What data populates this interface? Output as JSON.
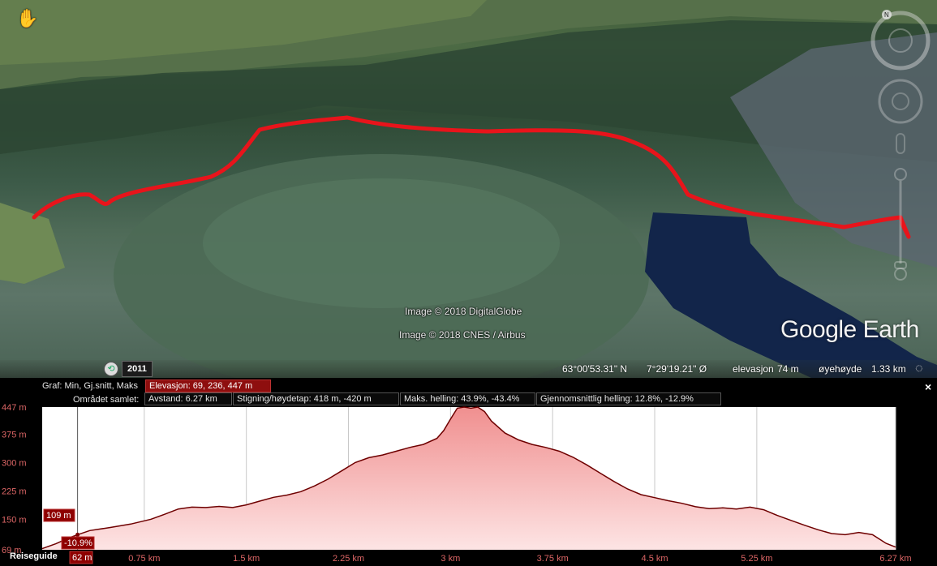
{
  "map": {
    "attribution_1": "Image © 2018 DigitalGlobe",
    "attribution_2": "Image © 2018 CNES / Airbus",
    "logo": "Google Earth",
    "year": "2011",
    "compass_letter": "N",
    "route_color": "#e8141b",
    "lake_color": "#12254a"
  },
  "status": {
    "latitude": "63°00'53.31\" N",
    "longitude": "7°29'19.21\" Ø",
    "elevation_label": "elevasjon",
    "elevation_value": "74 m",
    "eye_label": "øyehøyde",
    "eye_value": "1.33 km"
  },
  "profile": {
    "row1_label": "Graf: Min, Gj.snitt, Maks",
    "elevation_stats": "Elevasjon: 69, 236, 447 m",
    "row2_label": "Området samlet:",
    "distance": "Avstand: 6.27 km",
    "climb": "Stigning/høydetap: 418 m, -420 m",
    "max_grade": "Maks. helling: 43.9%, -43.4%",
    "avg_grade": "Gjennomsnittlig helling: 12.8%, -12.9%",
    "close": "×",
    "guide": "Reiseguide",
    "cursor_elevation": "109 m",
    "cursor_grade": "-10.9%",
    "cursor_distance": "62 m"
  },
  "chart_data": {
    "type": "area",
    "x_unit": "km",
    "y_unit": "m",
    "ylim": [
      69,
      447
    ],
    "xlim": [
      0,
      6.27
    ],
    "yticks": [
      "447 m",
      "375 m",
      "300 m",
      "225 m",
      "150 m",
      "69 m"
    ],
    "xticks": [
      "0.75 km",
      "1.5 km",
      "2.25 km",
      "3 km",
      "3.75 km",
      "4.5 km",
      "5.25 km",
      "6.27 km"
    ],
    "fill_color": "#f5b3b3",
    "line_color": "#6e0000",
    "points": [
      [
        0,
        72
      ],
      [
        0.1,
        85
      ],
      [
        0.2,
        101
      ],
      [
        0.26,
        109
      ],
      [
        0.35,
        120
      ],
      [
        0.5,
        128
      ],
      [
        0.65,
        137
      ],
      [
        0.8,
        150
      ],
      [
        0.9,
        163
      ],
      [
        1.0,
        177
      ],
      [
        1.1,
        182
      ],
      [
        1.2,
        181
      ],
      [
        1.3,
        184
      ],
      [
        1.4,
        181
      ],
      [
        1.5,
        188
      ],
      [
        1.6,
        198
      ],
      [
        1.7,
        208
      ],
      [
        1.8,
        214
      ],
      [
        1.9,
        223
      ],
      [
        2.0,
        238
      ],
      [
        2.1,
        256
      ],
      [
        2.2,
        278
      ],
      [
        2.3,
        300
      ],
      [
        2.4,
        313
      ],
      [
        2.5,
        320
      ],
      [
        2.6,
        330
      ],
      [
        2.7,
        340
      ],
      [
        2.8,
        348
      ],
      [
        2.9,
        364
      ],
      [
        2.95,
        385
      ],
      [
        3.0,
        415
      ],
      [
        3.05,
        444
      ],
      [
        3.1,
        447
      ],
      [
        3.15,
        444
      ],
      [
        3.2,
        447
      ],
      [
        3.25,
        435
      ],
      [
        3.3,
        410
      ],
      [
        3.4,
        378
      ],
      [
        3.5,
        360
      ],
      [
        3.6,
        348
      ],
      [
        3.7,
        340
      ],
      [
        3.8,
        330
      ],
      [
        3.9,
        314
      ],
      [
        4.0,
        294
      ],
      [
        4.1,
        272
      ],
      [
        4.2,
        250
      ],
      [
        4.3,
        230
      ],
      [
        4.4,
        215
      ],
      [
        4.5,
        207
      ],
      [
        4.6,
        199
      ],
      [
        4.7,
        192
      ],
      [
        4.8,
        183
      ],
      [
        4.9,
        178
      ],
      [
        5.0,
        180
      ],
      [
        5.1,
        177
      ],
      [
        5.2,
        182
      ],
      [
        5.3,
        175
      ],
      [
        5.4,
        160
      ],
      [
        5.5,
        147
      ],
      [
        5.6,
        134
      ],
      [
        5.7,
        122
      ],
      [
        5.8,
        112
      ],
      [
        5.9,
        109
      ],
      [
        6.0,
        115
      ],
      [
        6.1,
        109
      ],
      [
        6.2,
        86
      ],
      [
        6.27,
        76
      ]
    ],
    "cursor_x": 0.26
  }
}
